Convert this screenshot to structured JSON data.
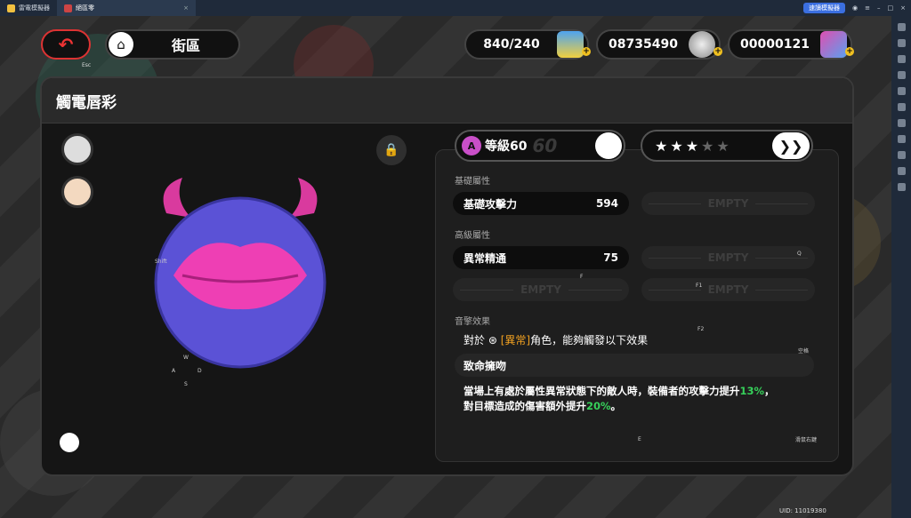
{
  "titlebar": {
    "tabs": [
      {
        "label": "雷電模擬器"
      },
      {
        "label": "絕區零"
      }
    ],
    "speed_button": "速讀模擬器"
  },
  "nav": {
    "esc_label": "Esc",
    "location": "街區"
  },
  "resources": [
    {
      "value": "840/240",
      "icon": "battery-icon"
    },
    {
      "value": "08735490",
      "icon": "coin-icon"
    },
    {
      "value": "00000121",
      "icon": "film-icon"
    }
  ],
  "panel": {
    "title": "觸電唇彩",
    "level_label": "等級60",
    "level_ghost": "60",
    "level_badge": "A",
    "stars_on": 3,
    "stars_total": 5,
    "base_stats_label": "基礎屬性",
    "base_stat": {
      "name": "基礎攻擊力",
      "value": "594"
    },
    "adv_stats_label": "高級屬性",
    "adv_stat": {
      "name": "異常精通",
      "value": "75"
    },
    "empty_label": "EMPTY",
    "effect_label": "音擎效果",
    "effect_prefix": "對於",
    "effect_tag": "[異常]",
    "effect_suffix": "角色，能夠觸發以下效果",
    "effect_name": "致命擁吻",
    "desc_1a": "當場上有處於屬性異常狀態下的敵人時，裝備者的攻擊力提升",
    "desc_1b": "13%",
    "desc_1c": "，",
    "desc_2a": "對目標造成的傷害額外提升",
    "desc_2b": "20%",
    "desc_2c": "。"
  },
  "hints": {
    "shift": "Shift",
    "w": "W",
    "a": "A",
    "s": "S",
    "d": "D",
    "f": "F",
    "f1": "F1",
    "f2": "F2",
    "q": "Q",
    "e": "E",
    "space": "空格",
    "scroll": "滑鼠右鍵"
  },
  "uid": "UID: 11019380",
  "colors": {
    "accent_red": "#dd3333",
    "pink": "#e83aa8",
    "purple": "#5a4fd0",
    "green": "#36d05a",
    "orange": "#f0a020"
  }
}
